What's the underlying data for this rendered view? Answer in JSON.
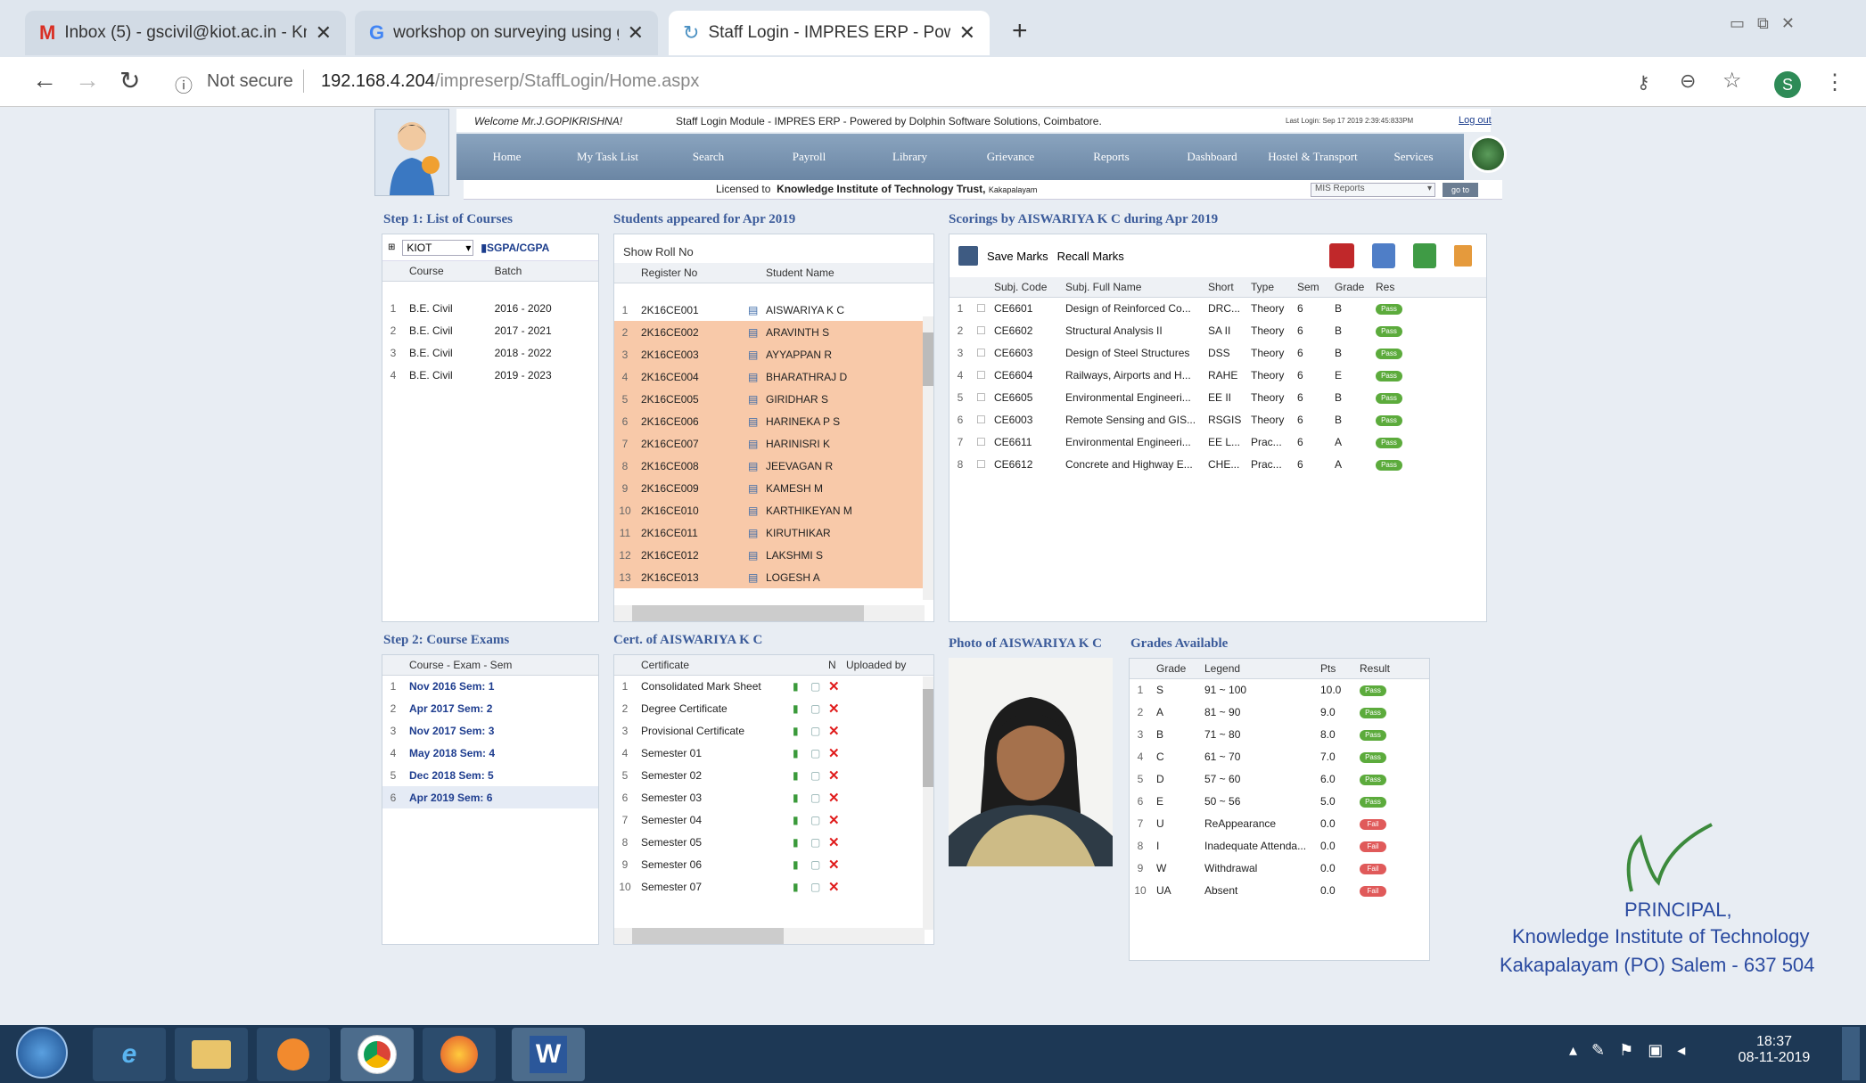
{
  "browser": {
    "tabs": [
      {
        "label": "Inbox (5) - gscivil@kiot.ac.in - Kn"
      },
      {
        "label": "workshop on surveying using ge"
      },
      {
        "label": "Staff Login - IMPRES ERP - Pow"
      }
    ],
    "not_secure": "Not secure",
    "url_host": "192.168.4.204",
    "url_path": "/impreserp/StaffLogin/Home.aspx",
    "new_tab": "+"
  },
  "header": {
    "welcome": "Welcome Mr.J.GOPIKRISHNA!",
    "module": "Staff Login Module - IMPRES ERP - Powered by Dolphin Software Solutions, Coimbatore.",
    "last_login": "Last Login: Sep 17 2019 2:39:45:833PM",
    "logout": "Log out",
    "licensed_to": "Licensed to",
    "licensee": "Knowledge Institute of Technology Trust,",
    "licensee_place": "Kakapalayam",
    "mis": "MIS Reports",
    "go": "go to"
  },
  "nav": [
    "Home",
    "My Task List",
    "Search",
    "Payroll",
    "Library",
    "Grievance",
    "Reports",
    "Dashboard",
    "Hostel & Transport",
    "Services"
  ],
  "courses": {
    "title": "Step 1: List of Courses",
    "inst": "KIOT",
    "sgpa": "SGPA/CGPA",
    "cols": [
      "Course",
      "Batch"
    ],
    "rows": [
      [
        "1",
        "B.E. Civil",
        "2016 - 2020"
      ],
      [
        "2",
        "B.E. Civil",
        "2017 - 2021"
      ],
      [
        "3",
        "B.E. Civil",
        "2018 - 2022"
      ],
      [
        "4",
        "B.E. Civil",
        "2019 - 2023"
      ]
    ]
  },
  "students": {
    "title": "Students appeared for Apr 2019",
    "show_roll": "Show Roll No",
    "cols": [
      "Register No",
      "Student Name"
    ],
    "rows": [
      [
        "1",
        "2K16CE001",
        "AISWARIYA K C"
      ],
      [
        "2",
        "2K16CE002",
        "ARAVINTH S"
      ],
      [
        "3",
        "2K16CE003",
        "AYYAPPAN R"
      ],
      [
        "4",
        "2K16CE004",
        "BHARATHRAJ D"
      ],
      [
        "5",
        "2K16CE005",
        "GIRIDHAR S"
      ],
      [
        "6",
        "2K16CE006",
        "HARINEKA P S"
      ],
      [
        "7",
        "2K16CE007",
        "HARINISRI K"
      ],
      [
        "8",
        "2K16CE008",
        "JEEVAGAN R"
      ],
      [
        "9",
        "2K16CE009",
        "KAMESH M"
      ],
      [
        "10",
        "2K16CE010",
        "KARTHIKEYAN M"
      ],
      [
        "11",
        "2K16CE011",
        "KIRUTHIKAR"
      ],
      [
        "12",
        "2K16CE012",
        "LAKSHMI S"
      ],
      [
        "13",
        "2K16CE013",
        "LOGESH A"
      ]
    ]
  },
  "scorings": {
    "title": "Scorings by AISWARIYA K C during Apr 2019",
    "save": "Save Marks",
    "recall": "Recall Marks",
    "cols": [
      "Subj. Code",
      "Subj. Full Name",
      "Short",
      "Type",
      "Sem",
      "Grade",
      "Res"
    ],
    "rows": [
      [
        "1",
        "CE6601",
        "Design of Reinforced Co...",
        "DRC...",
        "Theory",
        "6",
        "B",
        "Pass"
      ],
      [
        "2",
        "CE6602",
        "Structural Analysis II",
        "SA II",
        "Theory",
        "6",
        "B",
        "Pass"
      ],
      [
        "3",
        "CE6603",
        "Design of Steel Structures",
        "DSS",
        "Theory",
        "6",
        "B",
        "Pass"
      ],
      [
        "4",
        "CE6604",
        "Railways, Airports and H...",
        "RAHE",
        "Theory",
        "6",
        "E",
        "Pass"
      ],
      [
        "5",
        "CE6605",
        "Environmental Engineeri...",
        "EE II",
        "Theory",
        "6",
        "B",
        "Pass"
      ],
      [
        "6",
        "CE6003",
        "Remote Sensing and GIS...",
        "RSGIS",
        "Theory",
        "6",
        "B",
        "Pass"
      ],
      [
        "7",
        "CE6611",
        "Environmental Engineeri...",
        "EE L...",
        "Prac...",
        "6",
        "A",
        "Pass"
      ],
      [
        "8",
        "CE6612",
        "Concrete and Highway E...",
        "CHE...",
        "Prac...",
        "6",
        "A",
        "Pass"
      ]
    ]
  },
  "exams": {
    "title": "Step 2: Course Exams",
    "col": "Course - Exam - Sem",
    "rows": [
      [
        "1",
        "Nov 2016 Sem: 1"
      ],
      [
        "2",
        "Apr 2017 Sem: 2"
      ],
      [
        "3",
        "Nov 2017 Sem: 3"
      ],
      [
        "4",
        "May 2018 Sem: 4"
      ],
      [
        "5",
        "Dec 2018 Sem: 5"
      ],
      [
        "6",
        "Apr 2019 Sem: 6"
      ]
    ]
  },
  "certs": {
    "title": "Cert. of AISWARIYA K C",
    "cols": [
      "Certificate",
      "N",
      "Uploaded by"
    ],
    "rows": [
      [
        "1",
        "Consolidated Mark Sheet"
      ],
      [
        "2",
        "Degree Certificate"
      ],
      [
        "3",
        "Provisional Certificate"
      ],
      [
        "4",
        "Semester 01"
      ],
      [
        "5",
        "Semester 02"
      ],
      [
        "6",
        "Semester 03"
      ],
      [
        "7",
        "Semester 04"
      ],
      [
        "8",
        "Semester 05"
      ],
      [
        "9",
        "Semester 06"
      ],
      [
        "10",
        "Semester 07"
      ]
    ]
  },
  "photo": {
    "title": "Photo of AISWARIYA K C"
  },
  "grades": {
    "title": "Grades Available",
    "cols": [
      "Grade",
      "Legend",
      "Pts",
      "Result"
    ],
    "rows": [
      [
        "1",
        "S",
        "91 ~ 100",
        "10.0",
        "Pass"
      ],
      [
        "2",
        "A",
        "81 ~ 90",
        "9.0",
        "Pass"
      ],
      [
        "3",
        "B",
        "71 ~ 80",
        "8.0",
        "Pass"
      ],
      [
        "4",
        "C",
        "61 ~ 70",
        "7.0",
        "Pass"
      ],
      [
        "5",
        "D",
        "57 ~ 60",
        "6.0",
        "Pass"
      ],
      [
        "6",
        "E",
        "50 ~ 56",
        "5.0",
        "Pass"
      ],
      [
        "7",
        "U",
        "ReAppearance",
        "0.0",
        "Fail"
      ],
      [
        "8",
        "I",
        "Inadequate Attenda...",
        "0.0",
        "Fail"
      ],
      [
        "9",
        "W",
        "Withdrawal",
        "0.0",
        "Fail"
      ],
      [
        "10",
        "UA",
        "Absent",
        "0.0",
        "Fail"
      ]
    ]
  },
  "stamp": {
    "line1": "PRINCIPAL,",
    "line2": "Knowledge Institute of Technology",
    "line3": "Kakapalayam (PO) Salem - 637 504"
  },
  "taskbar": {
    "time": "18:37",
    "date": "08-11-2019"
  }
}
